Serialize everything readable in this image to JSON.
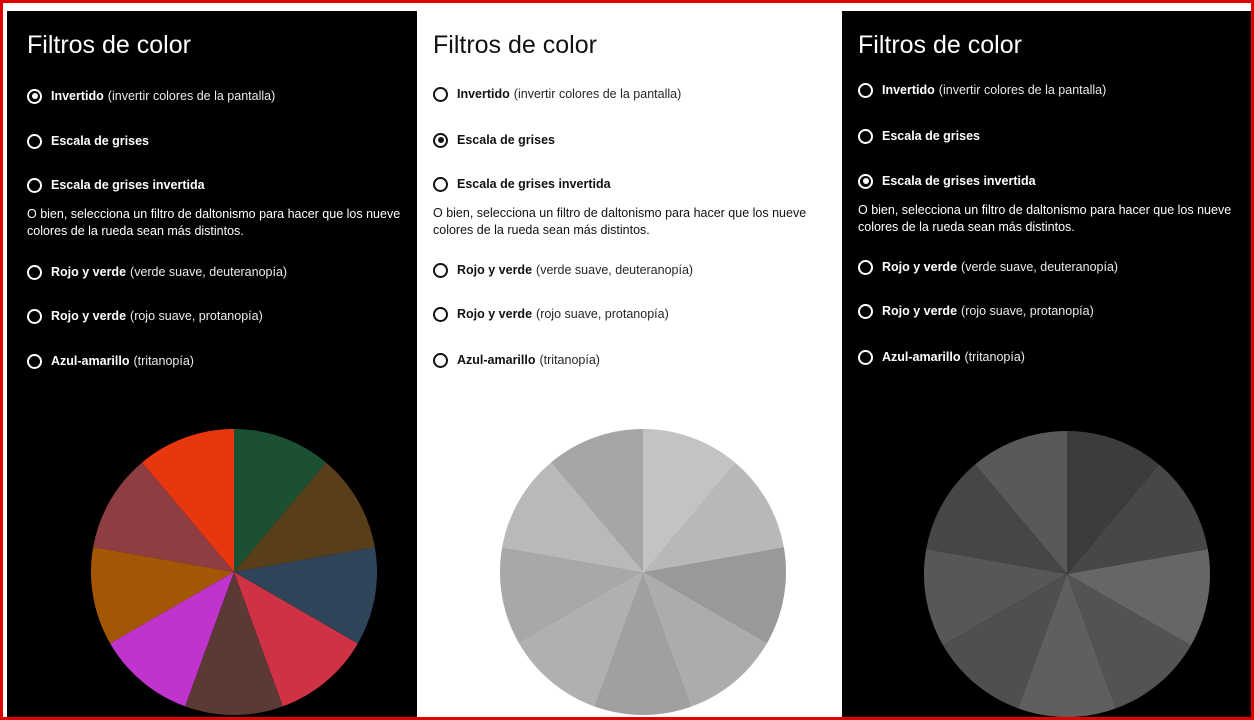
{
  "panels": [
    {
      "title": "Filtros de color",
      "options": [
        {
          "label": "Invertido",
          "desc": "(invertir colores de la pantalla)",
          "checked": true
        },
        {
          "label": "Escala de grises",
          "desc": "",
          "checked": false
        },
        {
          "label": "Escala de grises invertida",
          "desc": "",
          "checked": false
        },
        {
          "label": "Rojo y verde",
          "desc": "(verde suave, deuteranopía)",
          "checked": false
        },
        {
          "label": "Rojo y verde",
          "desc": "(rojo suave, protanopía)",
          "checked": false
        },
        {
          "label": "Azul-amarillo",
          "desc": "(tritanopía)",
          "checked": false
        }
      ],
      "description": "O bien, selecciona un filtro de daltonismo para hacer que los nueve colores de la rueda sean más distintos.",
      "wheel_colors": [
        "#593e1a",
        "#1c5033",
        "#e8360f",
        "#8e3e42",
        "#a35705",
        "#c034cd",
        "#5b3934",
        "#cf3145",
        "#2f4458"
      ],
      "wheel_color_names": [
        "olive",
        "dark green",
        "red orange",
        "rose brown",
        "orange brown",
        "magenta",
        "brown",
        "crimson",
        "slate blue"
      ]
    },
    {
      "title": "Filtros de color",
      "options": [
        {
          "label": "Invertido",
          "desc": "(invertir colores de la pantalla)",
          "checked": false
        },
        {
          "label": "Escala de grises",
          "desc": "",
          "checked": true
        },
        {
          "label": "Escala de grises invertida",
          "desc": "",
          "checked": false
        },
        {
          "label": "Rojo y verde",
          "desc": "(verde suave, deuteranopía)",
          "checked": false
        },
        {
          "label": "Rojo y verde",
          "desc": "(rojo suave, protanopía)",
          "checked": false
        },
        {
          "label": "Azul-amarillo",
          "desc": "(tritanopía)",
          "checked": false
        }
      ],
      "description": "O bien, selecciona un filtro de daltonismo para hacer que los nueve colores de la rueda sean más distintos.",
      "wheel_colors": [
        "#b8b8b8",
        "#c3c3c3",
        "#a6a6a6",
        "#b9b9b9",
        "#a8a8a8",
        "#b0b0b0",
        "#a0a0a0",
        "#acacac",
        "#999999"
      ],
      "wheel_color_names": [
        "gray",
        "gray",
        "gray",
        "gray",
        "gray",
        "gray",
        "gray",
        "gray",
        "gray"
      ]
    },
    {
      "title": "Filtros de color",
      "options": [
        {
          "label": "Invertido",
          "desc": "(invertir colores de la pantalla)",
          "checked": false
        },
        {
          "label": "Escala de grises",
          "desc": "",
          "checked": false
        },
        {
          "label": "Escala de grises invertida",
          "desc": "",
          "checked": true
        },
        {
          "label": "Rojo y verde",
          "desc": "(verde suave, deuteranopía)",
          "checked": false
        },
        {
          "label": "Rojo y verde",
          "desc": "(rojo suave, protanopía)",
          "checked": false
        },
        {
          "label": "Azul-amarillo",
          "desc": "(tritanopía)",
          "checked": false
        }
      ],
      "description": "O bien, selecciona un filtro de daltonismo para hacer que los nueve colores de la rueda sean más distintos.",
      "wheel_colors": [
        "#474747",
        "#3c3c3c",
        "#595959",
        "#464646",
        "#575757",
        "#4f4f4f",
        "#5f5f5f",
        "#535353",
        "#666666"
      ],
      "wheel_color_names": [
        "gray",
        "gray",
        "gray",
        "gray",
        "gray",
        "gray",
        "gray",
        "gray",
        "gray"
      ]
    }
  ]
}
